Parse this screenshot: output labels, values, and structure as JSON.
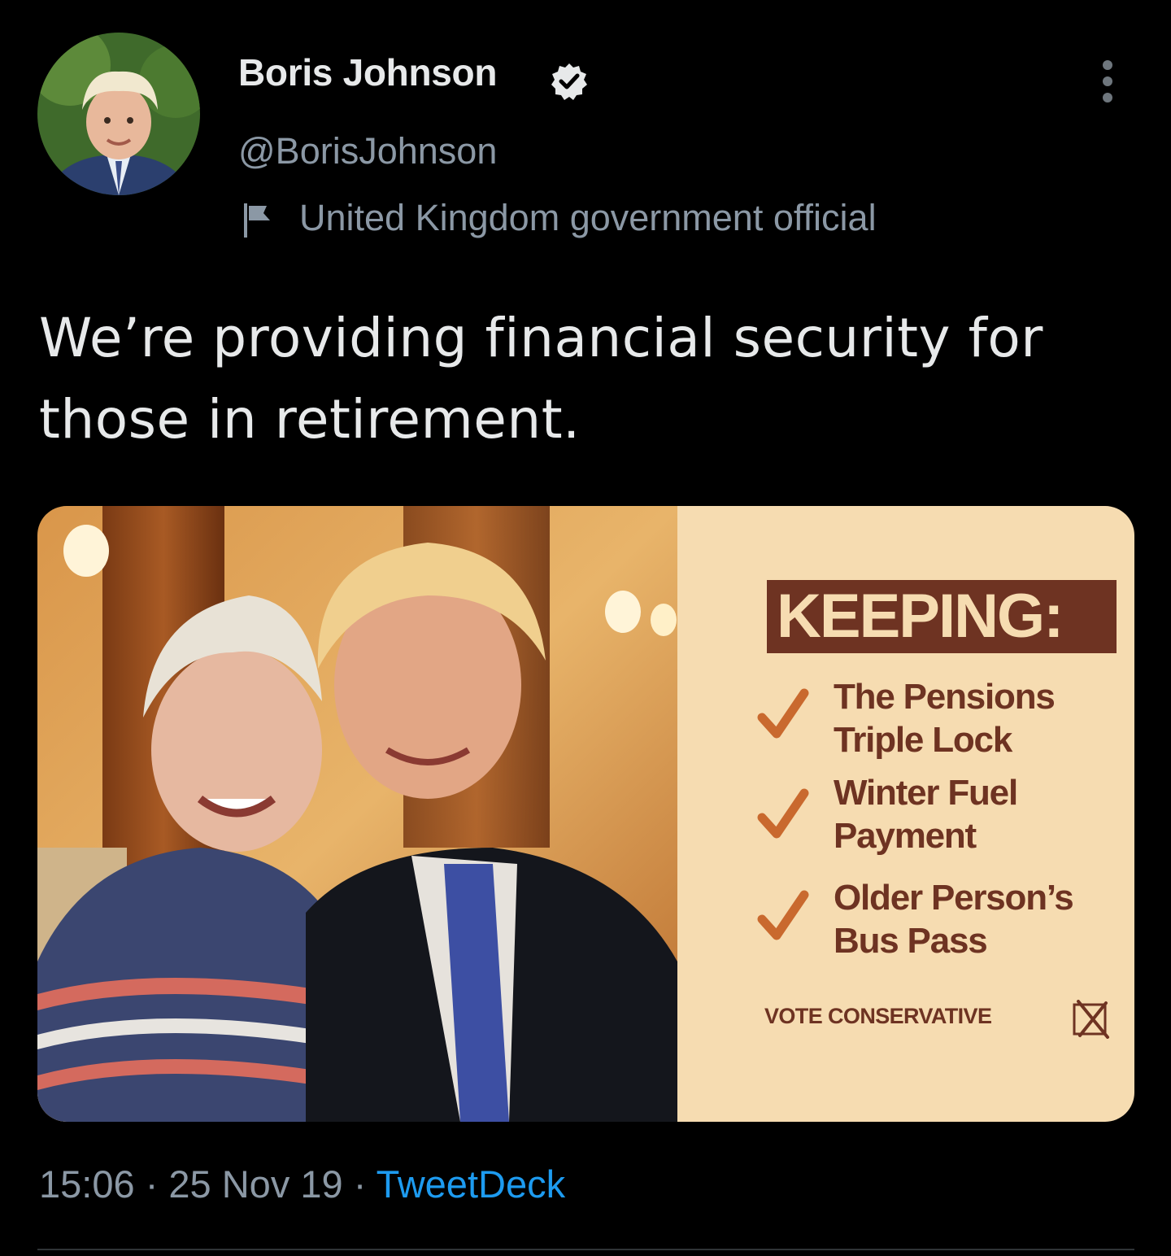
{
  "tweet": {
    "author": {
      "display_name": "Boris Johnson",
      "handle": "@BorisJohnson",
      "verified": true,
      "label": "United Kingdom government official"
    },
    "text": "We’re providing financial security for those in retirement.",
    "media": {
      "heading": "KEEPING:",
      "items": [
        {
          "line1": "The Pensions",
          "line2": "Triple Lock"
        },
        {
          "line1": "Winter Fuel",
          "line2": "Payment"
        },
        {
          "line1": "Older Person’s",
          "line2": "Bus Pass"
        }
      ],
      "footer": "VOTE CONSERVATIVE"
    },
    "time": "15:06",
    "date": "25 Nov 19",
    "separator": "·",
    "source": "TweetDeck"
  },
  "colors": {
    "background": "#000000",
    "text_primary": "#e7e9ea",
    "text_secondary": "#8b98a5",
    "link": "#1d9bf0",
    "panel_bg": "#f6dcb1",
    "panel_brown": "#6e3322",
    "check_orange": "#c9692e"
  },
  "icons": [
    "verified-badge-icon",
    "government-flag-icon",
    "more-options-icon",
    "checkmark-icon",
    "ballot-cross-icon"
  ]
}
